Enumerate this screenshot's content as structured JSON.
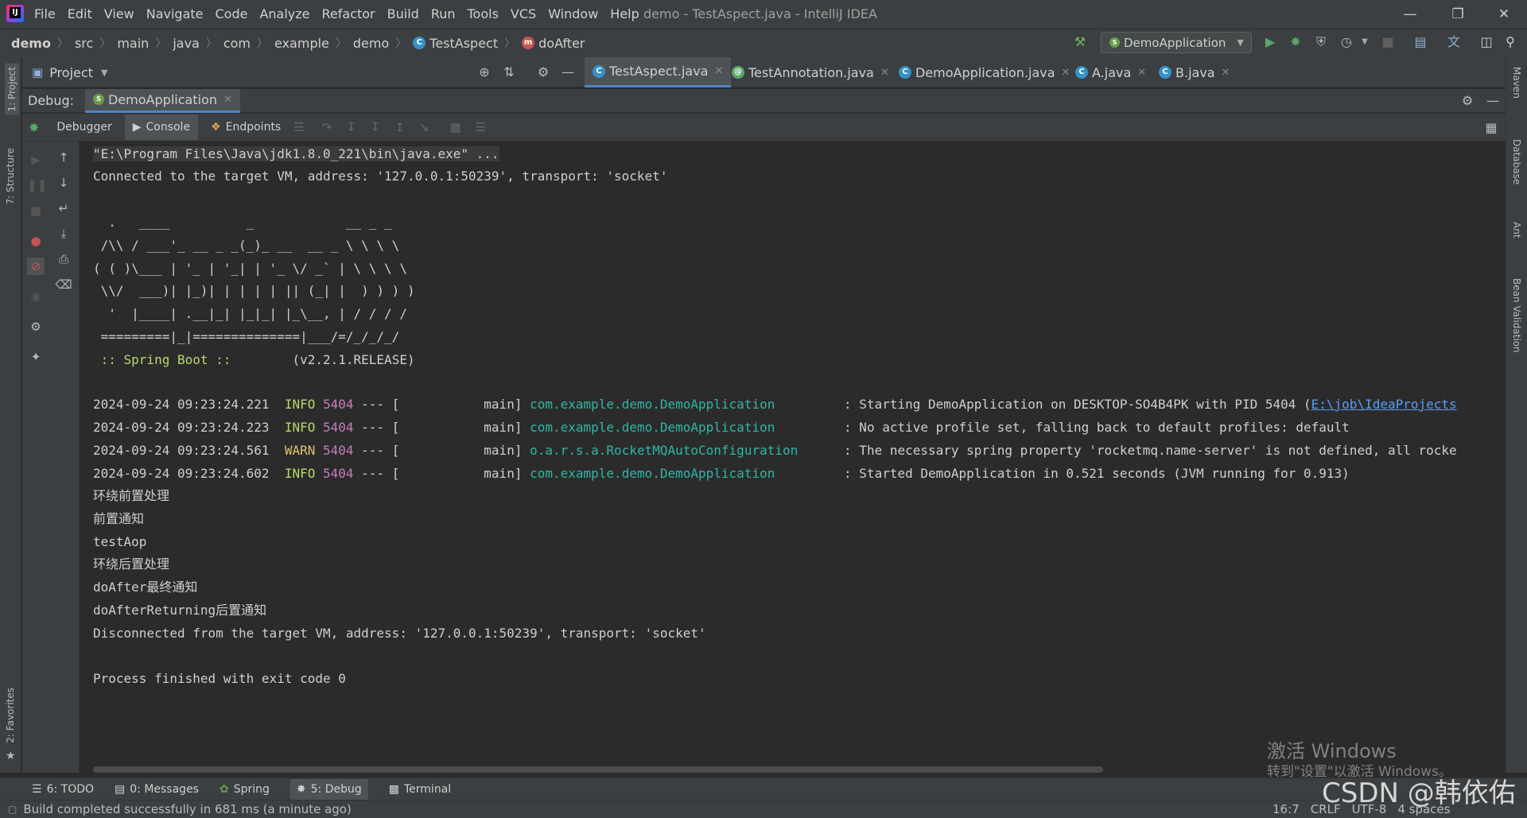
{
  "titlebar": {
    "menu": [
      "File",
      "Edit",
      "View",
      "Navigate",
      "Code",
      "Analyze",
      "Refactor",
      "Build",
      "Run",
      "Tools",
      "VCS",
      "Window",
      "Help"
    ],
    "title": "demo - TestAspect.java - IntelliJ IDEA"
  },
  "navbar": {
    "crumbs": [
      "demo",
      "src",
      "main",
      "java",
      "com",
      "example",
      "demo"
    ],
    "class_crumb": "TestAspect",
    "method_crumb": "doAfter",
    "run_config": "DemoApplication"
  },
  "project_bar": {
    "label": "Project"
  },
  "tabs": [
    {
      "label": "TestAspect.java",
      "icon": "class-icon"
    },
    {
      "label": "TestAnnotation.java",
      "icon": "annotation-icon"
    },
    {
      "label": "DemoApplication.java",
      "icon": "spring-class-icon"
    },
    {
      "label": "A.java",
      "icon": "class-icon"
    },
    {
      "label": "B.java",
      "icon": "class-icon"
    }
  ],
  "debug": {
    "label": "Debug:",
    "session": "DemoApplication",
    "subtabs": [
      "Debugger",
      "Console",
      "Endpoints"
    ]
  },
  "left_strip": {
    "project": "1: Project",
    "structure": "7: Structure",
    "favorites": "2: Favorites"
  },
  "right_strip": [
    "Maven",
    "Database",
    "Ant",
    "Bean Validation"
  ],
  "console": {
    "cmd": "\"E:\\Program Files\\Java\\jdk1.8.0_221\\bin\\java.exe\" ...",
    "connected": "Connected to the target VM, address: '127.0.0.1:50239', transport: 'socket'",
    "banner": [
      "  .   ____          _            __ _ _",
      " /\\\\ / ___'_ __ _ _(_)_ __  __ _ \\ \\ \\ \\",
      "( ( )\\___ | '_ | '_| | '_ \\/ _` | \\ \\ \\ \\",
      " \\\\/  ___)| |_)| | | | | || (_| |  ) ) ) )",
      "  '  |____| .__|_| |_|_| |_\\__, | / / / /",
      " =========|_|==============|___/=/_/_/_/"
    ],
    "spring_label": " :: Spring Boot :: ",
    "spring_version": "       (v2.2.1.RELEASE)",
    "logs": [
      {
        "ts": "2024-09-24 09:23:24.221",
        "level": "INFO",
        "pid": "5404",
        "sep": " --- [           main] ",
        "logger": "com.example.demo.DemoApplication        ",
        "msg": " : Starting DemoApplication on DESKTOP-SO4B4PK with PID 5404 (",
        "link": "E:\\job\\IdeaProjects"
      },
      {
        "ts": "2024-09-24 09:23:24.223",
        "level": "INFO",
        "pid": "5404",
        "sep": " --- [           main] ",
        "logger": "com.example.demo.DemoApplication        ",
        "msg": " : No active profile set, falling back to default profiles: default",
        "link": ""
      },
      {
        "ts": "2024-09-24 09:23:24.561",
        "level": "WARN",
        "pid": "5404",
        "sep": " --- [           main] ",
        "logger": "o.a.r.s.a.RocketMQAutoConfiguration     ",
        "msg": " : The necessary spring property 'rocketmq.name-server' is not defined, all rocke",
        "link": ""
      },
      {
        "ts": "2024-09-24 09:23:24.602",
        "level": "INFO",
        "pid": "5404",
        "sep": " --- [           main] ",
        "logger": "com.example.demo.DemoApplication        ",
        "msg": " : Started DemoApplication in 0.521 seconds (JVM running for 0.913)",
        "link": ""
      }
    ],
    "outputs": [
      "环绕前置处理",
      "前置通知",
      "testAop",
      "环绕后置处理",
      "doAfter最终通知",
      "doAfterReturning后置通知"
    ],
    "disconnected": "Disconnected from the target VM, address: '127.0.0.1:50239', transport: 'socket'",
    "finished": "Process finished with exit code 0"
  },
  "bottom_tools": [
    "6: TODO",
    "0: Messages",
    "Spring",
    "5: Debug",
    "Terminal"
  ],
  "status": {
    "message": "Build completed successfully in 681 ms (a minute ago)",
    "position": "16:7",
    "line_sep": "CRLF",
    "encoding": "UTF-8",
    "indent": "4 spaces"
  },
  "watermark": {
    "line1": "激活 Windows",
    "line2": "转到\"设置\"以激活 Windows。",
    "csdn": "CSDN @韩依佑"
  },
  "colors": {
    "accent": "#4a88c7",
    "info": "#b7d96a",
    "warn": "#e3c46a",
    "logger": "#2fb7a6"
  }
}
